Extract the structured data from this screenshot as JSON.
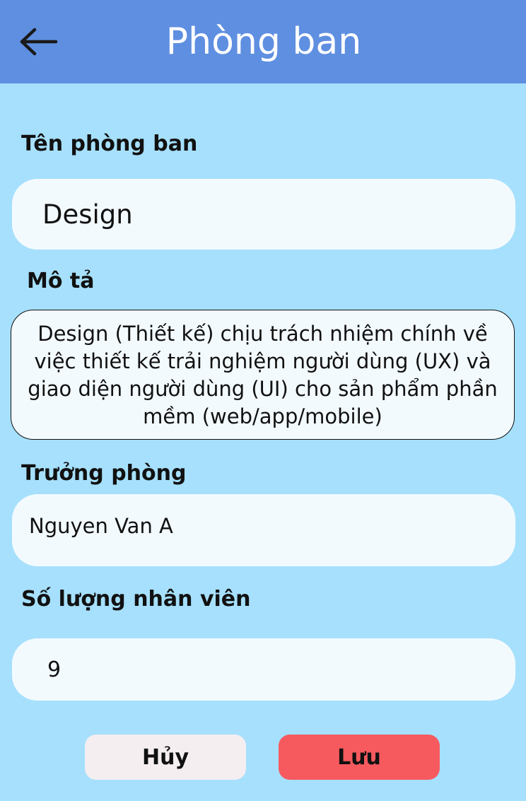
{
  "header": {
    "title": "Phòng ban",
    "back_icon": "arrow-left-icon"
  },
  "form": {
    "name_label": "Tên phòng ban",
    "name_value": "Design",
    "description_label": "Mô tả",
    "description_value": "Design (Thiết kế) chịu trách nhiệm chính về việc thiết kế trải nghiệm người dùng (UX) và giao diện người dùng (UI) cho sản phẩm phần mềm (web/app/mobile)",
    "manager_label": "Trưởng phòng",
    "manager_value": "Nguyen Van A",
    "staff_count_label": "Số lượng nhân viên",
    "staff_count_value": "9"
  },
  "actions": {
    "cancel_label": "Hủy",
    "save_label": "Lưu"
  },
  "colors": {
    "background": "#a6e0fd",
    "header": "#5f8fe0",
    "field": "#f3fafe",
    "cancel_button": "#f4eef1",
    "save_button": "#f65a5f"
  }
}
